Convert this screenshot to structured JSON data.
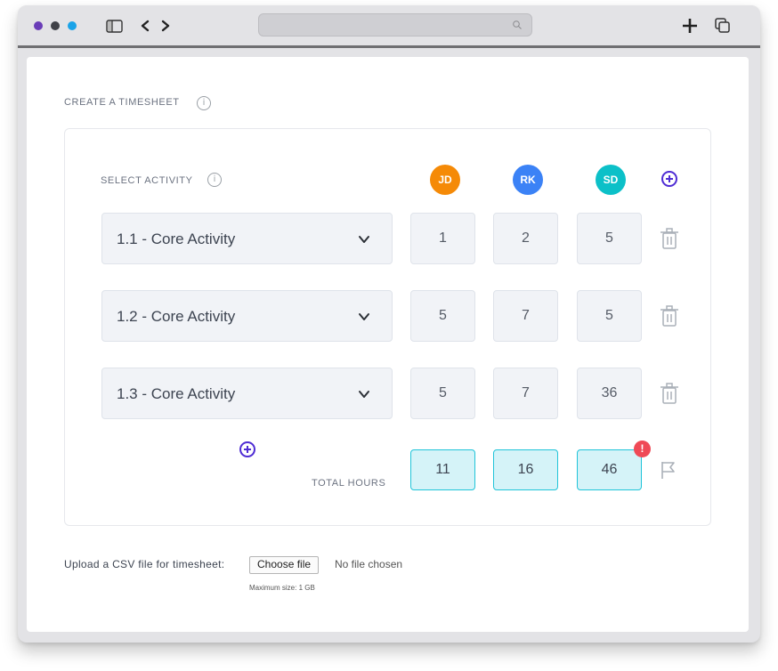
{
  "browser": {
    "traffic_lights": [
      "#6a3db8",
      "#3f4147",
      "#1aa3e8"
    ],
    "icons": [
      "sidebar-icon",
      "back-icon",
      "forward-icon",
      "search-icon",
      "new-tab-icon",
      "tabs-icon"
    ]
  },
  "form": {
    "title": "CREATE A TIMESHEET",
    "select_activity_label": "SELECT ACTIVITY",
    "people": [
      {
        "initials": "JD",
        "color": "#f58a07"
      },
      {
        "initials": "RK",
        "color": "#3b82f6"
      },
      {
        "initials": "SD",
        "color": "#0cc0c8"
      }
    ],
    "rows": [
      {
        "activity": "1.1 - Core Activity",
        "hours": [
          "1",
          "2",
          "5"
        ]
      },
      {
        "activity": "1.2 - Core Activity",
        "hours": [
          "5",
          "7",
          "5"
        ]
      },
      {
        "activity": "1.3 - Core Activity",
        "hours": [
          "5",
          "7",
          "36"
        ]
      }
    ],
    "total_label": "TOTAL HOURS",
    "totals": [
      "11",
      "16",
      "46"
    ],
    "alert_symbol": "!"
  },
  "upload": {
    "label": "Upload a CSV file for timesheet:",
    "button": "Choose file",
    "status": "No file chosen",
    "max_size": "Maximum size: 1 GB"
  },
  "colors": {
    "accent": "#4f2dd4",
    "total_border": "#20c4d9",
    "total_fill": "#d5f3f8",
    "alert": "#ef4a56"
  }
}
